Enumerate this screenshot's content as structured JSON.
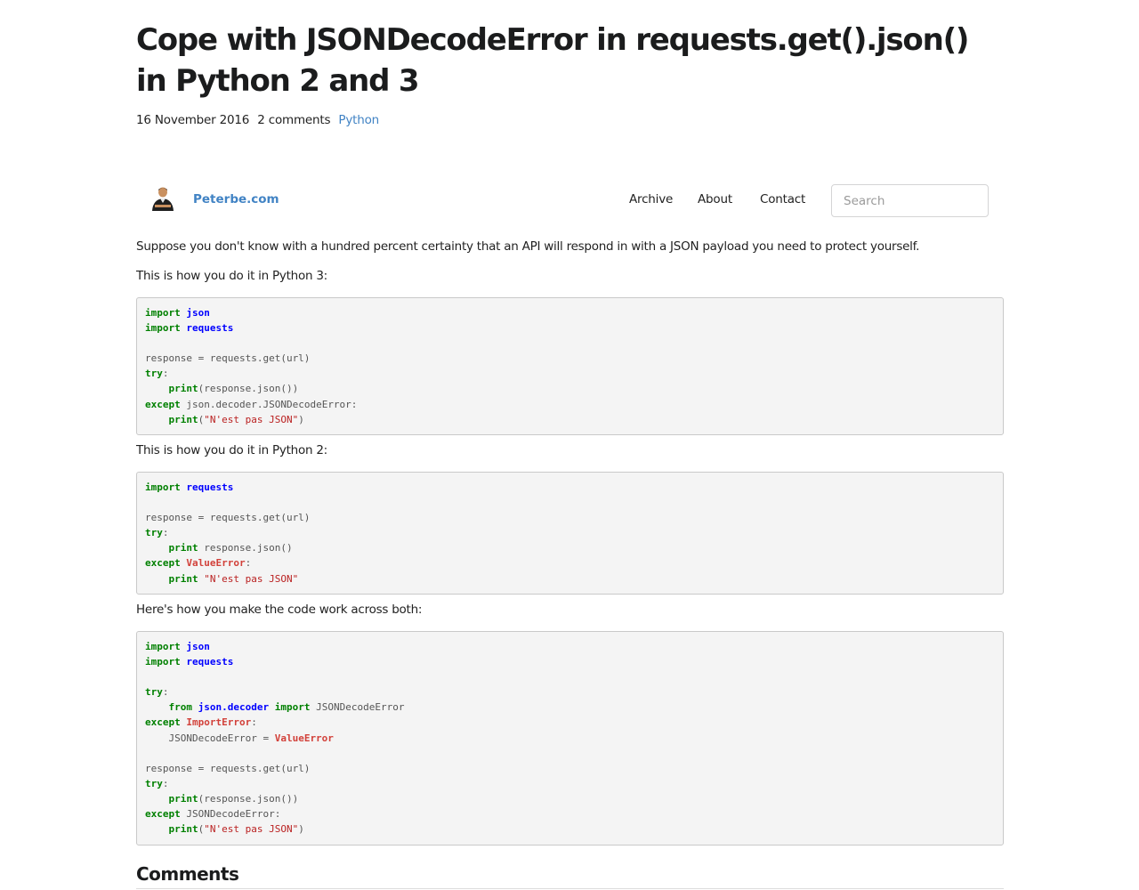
{
  "post": {
    "title": "Cope with JSONDecodeError in requests.get().json() in Python 2 and 3",
    "date": "16 November 2016",
    "comments_count": "2 comments",
    "category": "Python"
  },
  "nav": {
    "brand": "Peterbe.com",
    "items": [
      "Archive",
      "About",
      "Contact"
    ],
    "search_placeholder": "Search",
    "avatar_icon": "person-avatar-icon"
  },
  "body": {
    "intro": "Suppose you don't know with a hundred percent certainty that an API will respond in with a JSON payload you need to protect yourself.",
    "py3_lead": "This is how you do it in Python 3:",
    "py2_lead": "This is how you do it in Python 2:",
    "both_lead": "Here's how you make the code work across both:"
  },
  "code_blocks": {
    "py3": [
      [
        [
          "kw",
          "import"
        ],
        [
          "tx",
          " "
        ],
        [
          "nn",
          "json"
        ]
      ],
      [
        [
          "kw",
          "import"
        ],
        [
          "tx",
          " "
        ],
        [
          "nn",
          "requests"
        ]
      ],
      [],
      [
        [
          "tx",
          "response = requests.get(url)"
        ]
      ],
      [
        [
          "kw",
          "try"
        ],
        [
          "tx",
          ":"
        ]
      ],
      [
        [
          "tx",
          "    "
        ],
        [
          "kw",
          "print"
        ],
        [
          "tx",
          "(response.json())"
        ]
      ],
      [
        [
          "kw",
          "except"
        ],
        [
          "tx",
          " json.decoder.JSONDecodeError:"
        ]
      ],
      [
        [
          "tx",
          "    "
        ],
        [
          "kw",
          "print"
        ],
        [
          "tx",
          "("
        ],
        [
          "st",
          "\"N'est pas JSON\""
        ],
        [
          "tx",
          ")"
        ]
      ]
    ],
    "py2": [
      [
        [
          "kw",
          "import"
        ],
        [
          "tx",
          " "
        ],
        [
          "nn",
          "requests"
        ]
      ],
      [],
      [
        [
          "tx",
          "response = requests.get(url)"
        ]
      ],
      [
        [
          "kw",
          "try"
        ],
        [
          "tx",
          ":"
        ]
      ],
      [
        [
          "tx",
          "    "
        ],
        [
          "kw",
          "print"
        ],
        [
          "tx",
          " response.json()"
        ]
      ],
      [
        [
          "kw",
          "except"
        ],
        [
          "tx",
          " "
        ],
        [
          "ne",
          "ValueError"
        ],
        [
          "tx",
          ":"
        ]
      ],
      [
        [
          "tx",
          "    "
        ],
        [
          "kw",
          "print"
        ],
        [
          "tx",
          " "
        ],
        [
          "st",
          "\"N'est pas JSON\""
        ]
      ]
    ],
    "both": [
      [
        [
          "kw",
          "import"
        ],
        [
          "tx",
          " "
        ],
        [
          "nn",
          "json"
        ]
      ],
      [
        [
          "kw",
          "import"
        ],
        [
          "tx",
          " "
        ],
        [
          "nn",
          "requests"
        ]
      ],
      [],
      [
        [
          "kw",
          "try"
        ],
        [
          "tx",
          ":"
        ]
      ],
      [
        [
          "tx",
          "    "
        ],
        [
          "kw",
          "from"
        ],
        [
          "tx",
          " "
        ],
        [
          "nn",
          "json.decoder"
        ],
        [
          "tx",
          " "
        ],
        [
          "kw",
          "import"
        ],
        [
          "tx",
          " JSONDecodeError"
        ]
      ],
      [
        [
          "kw",
          "except"
        ],
        [
          "tx",
          " "
        ],
        [
          "ne",
          "ImportError"
        ],
        [
          "tx",
          ":"
        ]
      ],
      [
        [
          "tx",
          "    JSONDecodeError = "
        ],
        [
          "ne",
          "ValueError"
        ]
      ],
      [],
      [
        [
          "tx",
          "response = requests.get(url)"
        ]
      ],
      [
        [
          "kw",
          "try"
        ],
        [
          "tx",
          ":"
        ]
      ],
      [
        [
          "tx",
          "    "
        ],
        [
          "kw",
          "print"
        ],
        [
          "tx",
          "(response.json())"
        ]
      ],
      [
        [
          "kw",
          "except"
        ],
        [
          "tx",
          " JSONDecodeError:"
        ]
      ],
      [
        [
          "tx",
          "    "
        ],
        [
          "kw",
          "print"
        ],
        [
          "tx",
          "("
        ],
        [
          "st",
          "\"N'est pas JSON\""
        ],
        [
          "tx",
          ")"
        ]
      ]
    ]
  },
  "comments": {
    "heading": "Comments"
  }
}
